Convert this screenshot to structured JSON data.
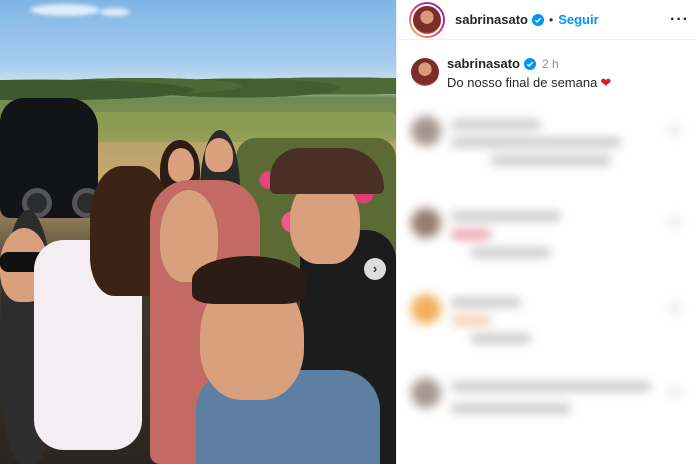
{
  "post": {
    "username": "sabrinasato",
    "follow_label": "Seguir",
    "separator": "•",
    "more_icon": "···",
    "next_icon": "›"
  },
  "caption": {
    "username": "sabrinasato",
    "time": "2 h",
    "text": "Do nosso final de semana",
    "heart": "❤"
  },
  "colors": {
    "accent": "#0095f6",
    "verified": "#0095f6",
    "heart": "#e0182d"
  },
  "icons": {
    "verified": "verified-badge-icon",
    "more": "more-options-icon",
    "next": "chevron-right-icon",
    "like": "heart-icon"
  }
}
